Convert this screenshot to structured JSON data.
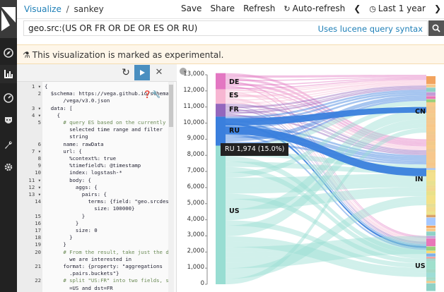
{
  "breadcrumb": {
    "root": "Visualize",
    "separator": "/",
    "current": "sankey"
  },
  "topmenu": {
    "save": "Save",
    "share": "Share",
    "refresh": "Refresh",
    "auto_refresh": "Auto-refresh",
    "time_range": "Last 1 year"
  },
  "query": {
    "value": "geo.src:(US OR FR OR DE OR ES OR RU)",
    "syntax_link": "Uses lucene query syntax"
  },
  "banner": {
    "text": "This visualization is marked as experimental."
  },
  "editor": {
    "lines": [
      {
        "n": "1",
        "f": true,
        "t": "{"
      },
      {
        "n": "2",
        "f": false,
        "t": "  $schema: https://vega.github.io/schema"
      },
      {
        "n": "",
        "f": false,
        "t": "      /vega/v3.0.json"
      },
      {
        "n": "3",
        "f": true,
        "t": "  data: ["
      },
      {
        "n": "4",
        "f": true,
        "t": "    {"
      },
      {
        "n": "5",
        "f": false,
        "t": "      # query ES based on the currently"
      },
      {
        "n": "",
        "f": false,
        "t": "        selected time range and filter"
      },
      {
        "n": "",
        "f": false,
        "t": "        string"
      },
      {
        "n": "6",
        "f": false,
        "t": "      name: rawData"
      },
      {
        "n": "7",
        "f": true,
        "t": "      url: {"
      },
      {
        "n": "8",
        "f": false,
        "t": "        %context%: true"
      },
      {
        "n": "9",
        "f": false,
        "t": "        %timefield%: @timestamp"
      },
      {
        "n": "10",
        "f": false,
        "t": "        index: logstash-*"
      },
      {
        "n": "11",
        "f": true,
        "t": "        body: {"
      },
      {
        "n": "12",
        "f": true,
        "t": "          aggs: {"
      },
      {
        "n": "13",
        "f": true,
        "t": "            pairs: {"
      },
      {
        "n": "14",
        "f": false,
        "t": "              terms: {field: \"geo.srcdest\","
      },
      {
        "n": "",
        "f": false,
        "t": "                size: 100000}"
      },
      {
        "n": "15",
        "f": false,
        "t": "            }"
      },
      {
        "n": "16",
        "f": false,
        "t": "          }"
      },
      {
        "n": "17",
        "f": false,
        "t": "          size: 0"
      },
      {
        "n": "18",
        "f": false,
        "t": "        }"
      },
      {
        "n": "19",
        "f": false,
        "t": "      }"
      },
      {
        "n": "20",
        "f": false,
        "t": "      # From the result, take just the data"
      },
      {
        "n": "",
        "f": false,
        "t": "        we are interested in"
      },
      {
        "n": "21",
        "f": false,
        "t": "      format: {property: \"aggregations"
      },
      {
        "n": "",
        "f": false,
        "t": "        .pairs.buckets\"}"
      },
      {
        "n": "22",
        "f": false,
        "t": "      # split \"US:FR\" into two fields, src"
      },
      {
        "n": "",
        "f": false,
        "t": "        =US and dst=FR"
      }
    ]
  },
  "chart_data": {
    "type": "sankey",
    "y_ticks": [
      "13,000",
      "12,000",
      "11,000",
      "10,000",
      "9,000",
      "8,000",
      "7,000",
      "6,000",
      "5,000",
      "4,000",
      "3,000",
      "2,000",
      "1,000",
      "0"
    ],
    "ylim": [
      0,
      13000
    ],
    "source_stack": [
      {
        "name": "DE",
        "start": 12100,
        "end": 13100,
        "color": "#e377c2"
      },
      {
        "name": "ES",
        "start": 11200,
        "end": 12100,
        "color": "#f7b6d2"
      },
      {
        "name": "FR",
        "start": 10400,
        "end": 11200,
        "color": "#9467bd"
      },
      {
        "name": "RU",
        "start": 8600,
        "end": 10400,
        "color": "#3a7fdd"
      },
      {
        "name": "US",
        "start": 0,
        "end": 8600,
        "color": "#98ddd2"
      }
    ],
    "source_labels": [
      "DE",
      "ES",
      "FR",
      "RU",
      "US"
    ],
    "dest_labels": [
      "CN",
      "IN",
      "US"
    ],
    "tooltip": "RU  1,974  (15.0%)",
    "colors": {
      "accent": "#1e7fb7",
      "banner_bg": "#fef6e9",
      "nav_bg": "#222222"
    }
  }
}
